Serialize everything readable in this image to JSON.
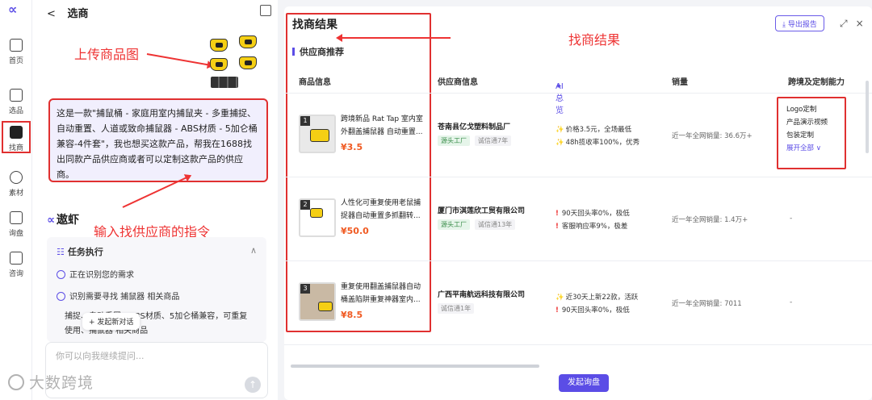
{
  "nav": {
    "items": [
      {
        "label": "首页"
      },
      {
        "label": "选品"
      },
      {
        "label": "找商"
      },
      {
        "label": "素材"
      },
      {
        "label": "询盘"
      },
      {
        "label": "咨询"
      }
    ]
  },
  "left": {
    "back": "<",
    "title": "选商",
    "annotation_upload": "上传商品图",
    "prompt": "这是一款\"捕鼠桶 - 家庭用室内捕鼠夹 - 多重捕捉、自动重置、人道或致命捕鼠器 - ABS材质 - 5加仑桶兼容-4件套\"，我也想买这款产品，帮我在1688找出同款产品供应商或者可以定制这款产品的供应商。",
    "annotation_input": "输入找供应商的指令",
    "agent_name": "遨虾",
    "tasks_title": "任务执行",
    "tasks": [
      {
        "label": "正在识别您的需求"
      },
      {
        "label": "识别需要寻找 捕鼠器 相关商品"
      }
    ],
    "task_extra": "捕捉、自动重置、ABS材质、5加仑桶兼容，可重复使用、捕鼠器 相关商品",
    "new_chat": "发起新对话",
    "input_placeholder": "你可以向我继续提问...",
    "watermark": "大数跨境"
  },
  "results": {
    "title": "找商结果",
    "annotation": "找商结果",
    "export": "导出报告",
    "subtitle": "供应商推荐",
    "headers": {
      "product": "商品信息",
      "supplier": "供应商信息",
      "ai": "AI总览",
      "sales": "销量",
      "capability": "跨境及定制能力"
    },
    "rows": [
      {
        "rank": "1",
        "name": "跨境新品 Rat Tap 室内室外翻盖捕鼠器 自动重置...",
        "price": "¥3.5",
        "supplier": "苍南县亿戈塑料制品厂",
        "badge": "源头工厂",
        "cred": "诚信通7年",
        "ai1": "价格3.5元，全场最低",
        "ai2": "48h揽收率100%，优秀",
        "sales": "近一年全网销量: 36.6万+",
        "caps": [
          "Logo定制",
          "产品演示视频",
          "包装定制"
        ],
        "caps_more": "展开全部 ∨"
      },
      {
        "rank": "2",
        "name": "人性化可重复使用老鼠捕捉器自动重置多抓翻转...",
        "price": "¥50.0",
        "supplier": "厦门市淇莲欣工贸有限公司",
        "badge": "源头工厂",
        "cred": "诚信通13年",
        "ai1": "90天回头率0%，极低",
        "ai2": "客服响应率9%，极差",
        "sales": "近一年全网销量: 1.4万+",
        "cap": "-"
      },
      {
        "rank": "3",
        "name": "重复使用翻盖捕鼠器自动桶盖陷阱重复神器室内...",
        "price": "¥8.5",
        "supplier": "广西平南航远科技有限公司",
        "cred": "诚信通1年",
        "ai1": "近30天上新22款，活跃",
        "ai2": "90天回头率0%，极低",
        "sales": "近一年全网销量: 7011",
        "cap": "-"
      }
    ],
    "inquiry_button": "发起询盘"
  }
}
